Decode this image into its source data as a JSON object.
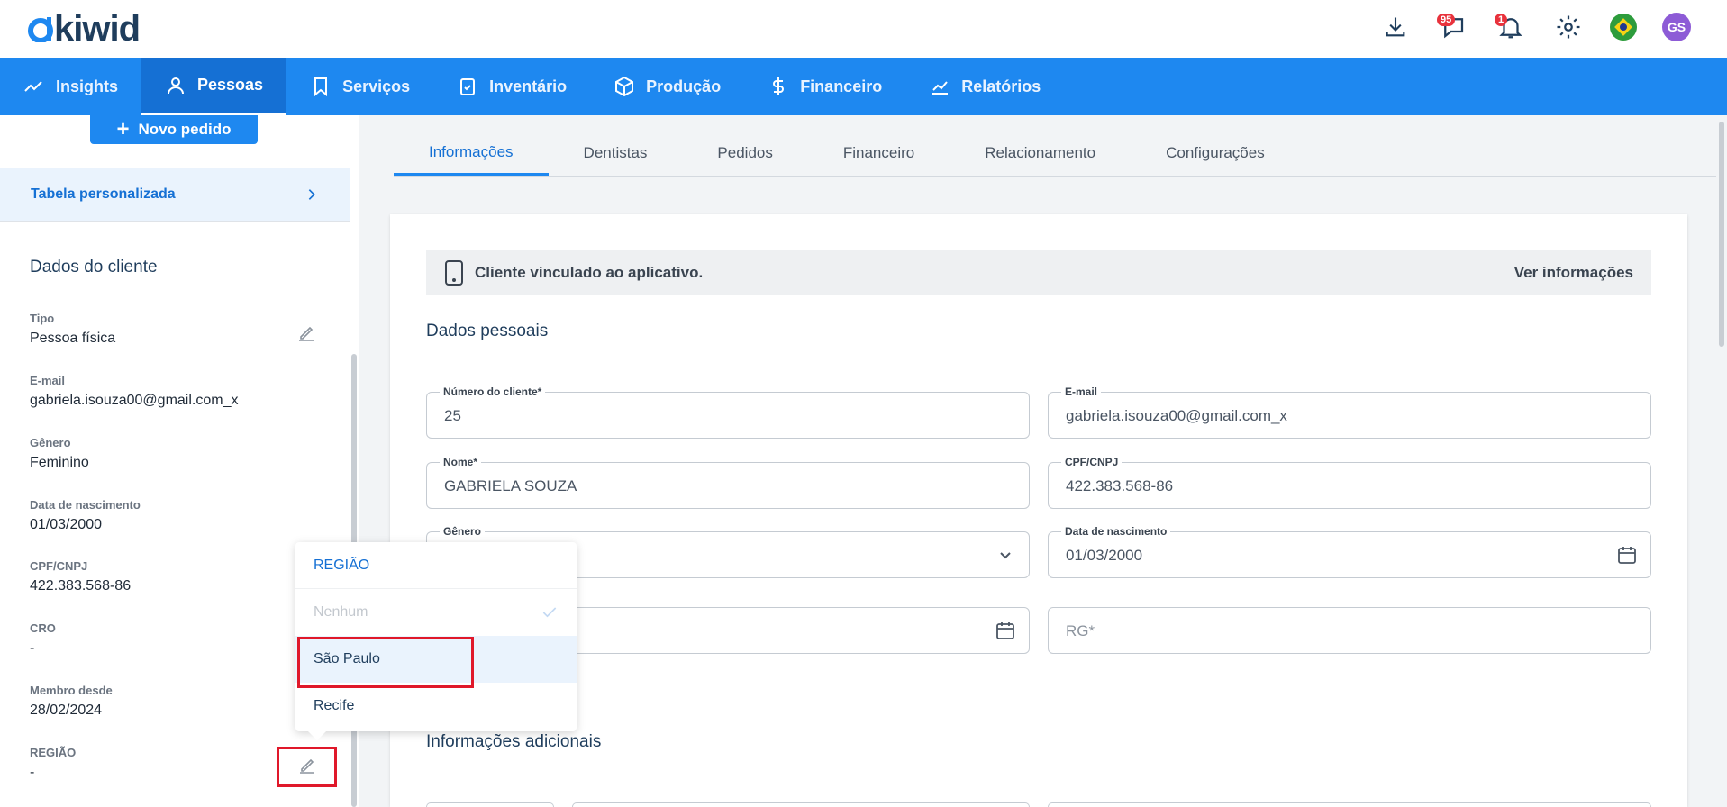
{
  "brand": {
    "name": "kiwid"
  },
  "topbar": {
    "messages_badge": "95",
    "notifications_badge": "1",
    "avatar_initials": "GS"
  },
  "nav": {
    "items": [
      {
        "label": "Insights",
        "icon": "trend-icon"
      },
      {
        "label": "Pessoas",
        "icon": "person-icon",
        "active": true
      },
      {
        "label": "Serviços",
        "icon": "bookmark-icon"
      },
      {
        "label": "Inventário",
        "icon": "clipboard-check-icon"
      },
      {
        "label": "Produção",
        "icon": "box-icon"
      },
      {
        "label": "Financeiro",
        "icon": "dollar-icon"
      },
      {
        "label": "Relatórios",
        "icon": "chart-icon"
      }
    ]
  },
  "sidebar": {
    "new_order_label": "Novo pedido",
    "custom_table_label": "Tabela personalizada",
    "section_title": "Dados do cliente",
    "fields": {
      "tipo": {
        "label": "Tipo",
        "value": "Pessoa física"
      },
      "email": {
        "label": "E-mail",
        "value": "gabriela.isouza00@gmail.com_x"
      },
      "genero": {
        "label": "Gênero",
        "value": "Feminino"
      },
      "nascimento": {
        "label": "Data de nascimento",
        "value": "01/03/2000"
      },
      "cpf": {
        "label": "CPF/CNPJ",
        "value": "422.383.568-86"
      },
      "cro": {
        "label": "CRO",
        "value": "-"
      },
      "membro": {
        "label": "Membro desde",
        "value": "28/02/2024"
      },
      "regiao": {
        "label": "REGIÃO",
        "value": "-"
      }
    }
  },
  "tabs": [
    "Informações",
    "Dentistas",
    "Pedidos",
    "Financeiro",
    "Relacionamento",
    "Configurações"
  ],
  "banner": {
    "text": "Cliente vinculado ao aplicativo.",
    "action": "Ver informações"
  },
  "form": {
    "section_personal": "Dados pessoais",
    "section_additional": "Informações adicionais",
    "numero": {
      "label": "Número do cliente*",
      "value": "25"
    },
    "email": {
      "label": "E-mail",
      "value": "gabriela.isouza00@gmail.com_x"
    },
    "nome": {
      "label": "Nome*",
      "value": "GABRIELA SOUZA"
    },
    "cpf": {
      "label": "CPF/CNPJ",
      "value": "422.383.568-86"
    },
    "genero": {
      "label": "Gênero"
    },
    "nascimento": {
      "label": "Data de nascimento",
      "value": "01/03/2000"
    },
    "rg": {
      "placeholder": "RG*"
    }
  },
  "dropdown": {
    "header": "REGIÃO",
    "options": [
      {
        "label": "Nenhum",
        "disabled": true,
        "selected": true
      },
      {
        "label": "São Paulo",
        "hover": true
      },
      {
        "label": "Recife"
      }
    ]
  },
  "colors": {
    "primary": "#1e88f0",
    "highlight": "#e0182a"
  }
}
